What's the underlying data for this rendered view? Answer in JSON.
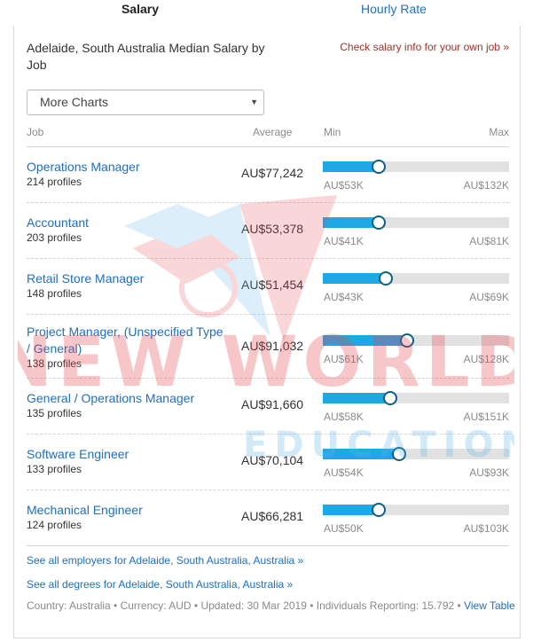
{
  "tabs": [
    {
      "label": "Salary",
      "active": true
    },
    {
      "label": "Hourly Rate",
      "active": false
    }
  ],
  "header": {
    "title": "Adelaide, South Australia Median Salary by Job",
    "own_job_link": "Check salary info for your own job »"
  },
  "dropdown": {
    "selected": "More Charts"
  },
  "columns": {
    "job": "Job",
    "average": "Average",
    "min": "Min",
    "max": "Max"
  },
  "rows": [
    {
      "job": "Operations Manager",
      "profiles": "214 profiles",
      "average": "AU$77,242",
      "min": "AU$53K",
      "max": "AU$132K",
      "fraction": 0.3
    },
    {
      "job": "Accountant",
      "profiles": "203 profiles",
      "average": "AU$53,378",
      "min": "AU$41K",
      "max": "AU$81K",
      "fraction": 0.3
    },
    {
      "job": "Retail Store Manager",
      "profiles": "148 profiles",
      "average": "AU$51,454",
      "min": "AU$43K",
      "max": "AU$69K",
      "fraction": 0.34
    },
    {
      "job": "Project Manager, (Unspecified Type / General)",
      "profiles": "138 profiles",
      "average": "AU$91,032",
      "min": "AU$61K",
      "max": "AU$128K",
      "fraction": 0.45
    },
    {
      "job": "General / Operations Manager",
      "profiles": "135 profiles",
      "average": "AU$91,660",
      "min": "AU$58K",
      "max": "AU$151K",
      "fraction": 0.36
    },
    {
      "job": "Software Engineer",
      "profiles": "133 profiles",
      "average": "AU$70,104",
      "min": "AU$54K",
      "max": "AU$93K",
      "fraction": 0.41
    },
    {
      "job": "Mechanical Engineer",
      "profiles": "124 profiles",
      "average": "AU$66,281",
      "min": "AU$50K",
      "max": "AU$103K",
      "fraction": 0.3
    }
  ],
  "footer": {
    "employers_link": "See all employers for Adelaide, South Australia, Australia »",
    "degrees_link": "See all degrees for Adelaide, South Australia, Australia »",
    "meta": "Country: Australia • Currency: AUD • Updated: 30 Mar 2019 • Individuals Reporting: 15.792 •",
    "view_table": "View Table"
  },
  "watermark": {
    "line1": "NEW WORLD",
    "line2": "EDUCATION"
  },
  "colors": {
    "accent": "#1fa8e6",
    "link": "#1f6ec5",
    "knob_border": "#0f5f85",
    "watermark_red": "#e8474e",
    "watermark_blue": "#5fb6e6"
  }
}
